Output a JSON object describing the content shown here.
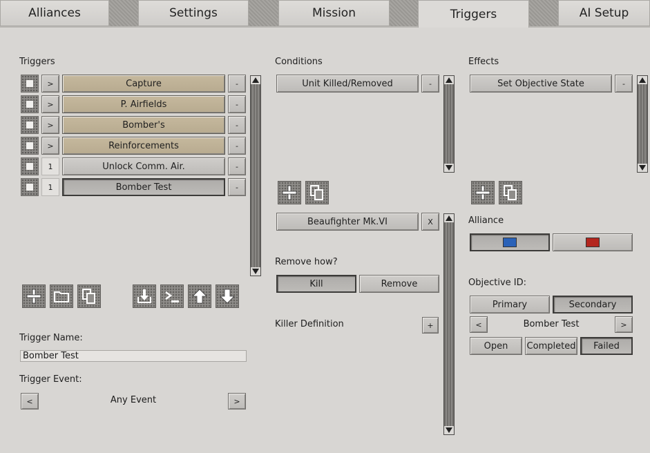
{
  "tabs": [
    "Alliances",
    "Settings",
    "Mission",
    "Triggers",
    "AI Setup"
  ],
  "active_tab": "Triggers",
  "triggers": {
    "heading": "Triggers",
    "rows": [
      {
        "expander": ">",
        "name": "Capture",
        "remove": "-"
      },
      {
        "expander": ">",
        "name": "P. Airfields",
        "remove": "-"
      },
      {
        "expander": ">",
        "name": "Bomber's",
        "remove": "-"
      },
      {
        "expander": ">",
        "name": "Reinforcements",
        "remove": "-"
      },
      {
        "expander": "1",
        "name": "Unlock Comm. Air.",
        "remove": "-"
      },
      {
        "expander": "1",
        "name": "Bomber Test",
        "remove": "-"
      }
    ],
    "toolbar_icons": [
      "add-icon",
      "folder-icon",
      "copy-icon",
      "import-icon",
      "terminal-icon",
      "move-up-icon",
      "move-down-icon"
    ],
    "name_label": "Trigger Name:",
    "name_value": "Bomber Test",
    "event_label": "Trigger Event:",
    "event_prev": "<",
    "event_value": "Any Event",
    "event_next": ">"
  },
  "conditions": {
    "heading": "Conditions",
    "items": [
      {
        "name": "Unit Killed/Removed",
        "remove": "-"
      }
    ],
    "unit": {
      "name": "Beaufighter Mk.VI",
      "remove": "X"
    },
    "remove_how_label": "Remove how?",
    "remove_how_options": [
      "Kill",
      "Remove"
    ],
    "remove_how_selected": "Kill",
    "killer_label": "Killer Definition",
    "killer_add": "+"
  },
  "effects": {
    "heading": "Effects",
    "items": [
      {
        "name": "Set Objective State",
        "remove": "-"
      }
    ],
    "alliance_label": "Alliance",
    "alliance_colors": [
      "#2a62b8",
      "#b3261e"
    ],
    "objective_label": "Objective ID:",
    "objective_types": [
      "Primary",
      "Secondary"
    ],
    "objective_type_selected": "Secondary",
    "objective_prev": "<",
    "objective_name": "Bomber Test",
    "objective_next": ">",
    "states": [
      "Open",
      "Completed",
      "Failed"
    ],
    "state_selected": "Failed"
  }
}
